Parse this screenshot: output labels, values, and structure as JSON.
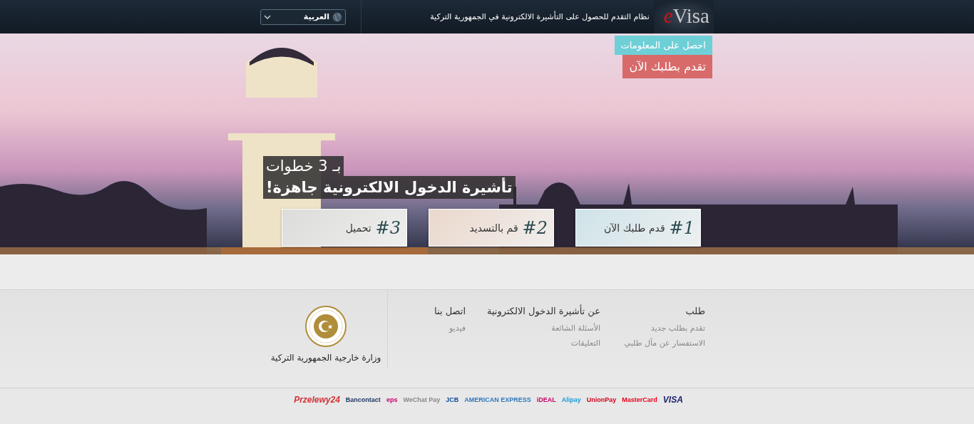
{
  "header": {
    "logo": "eVisa",
    "subtitle": "نظام التقدم للحصول على التأشيرة الالكترونية في الجمهورية التركية",
    "language": "العربية"
  },
  "hero": {
    "info_buttons": [
      {
        "label": "احصل على المعلومات",
        "kind": "info"
      },
      {
        "label": "تقدم بطلبك الآن",
        "kind": "apply"
      }
    ],
    "headline": [
      "بـ 3 خطوات",
      "تأشيرة الدخول الالكترونية جاهزة!"
    ],
    "steps": [
      {
        "number": "#1",
        "label": "قدم طلبك الآن",
        "color": "#cfe3e8"
      },
      {
        "number": "#2",
        "label": "قم بالتسديد",
        "color": "#ead8cc"
      },
      {
        "number": "#3",
        "label": "تحميل",
        "color": "#dcdcda"
      }
    ]
  },
  "footer": {
    "columns": [
      {
        "title": "طلب",
        "links": [
          "تقدم بطلب جديد",
          "الاستفسار عن مآل طلبي"
        ]
      },
      {
        "title": "عن تأشيرة الدخول الالكترونية",
        "links": [
          "الأسئلة الشائعة",
          "التعليقات"
        ]
      },
      {
        "title": "اتصل بنا",
        "links": [
          "فيديو"
        ]
      }
    ],
    "ministry": "وزارة خارجية الجمهورية التركية"
  },
  "payment_methods": [
    {
      "label": "VISA",
      "color": "#1a1f71"
    },
    {
      "label": "MasterCard",
      "color": "#eb001b"
    },
    {
      "label": "UnionPay",
      "color": "#d0021b"
    },
    {
      "label": "Alipay",
      "color": "#1b9bd8"
    },
    {
      "label": "iDEAL",
      "color": "#cc0066"
    },
    {
      "label": "AMERICAN EXPRESS",
      "color": "#2e77bb"
    },
    {
      "label": "JCB",
      "color": "#0e4c96"
    },
    {
      "label": "WeChat Pay",
      "color": "#888888"
    },
    {
      "label": "eps",
      "color": "#c8036f"
    },
    {
      "label": "Bancontact",
      "color": "#1e3764"
    },
    {
      "label": "Przelewy24",
      "color": "#d13239"
    }
  ]
}
